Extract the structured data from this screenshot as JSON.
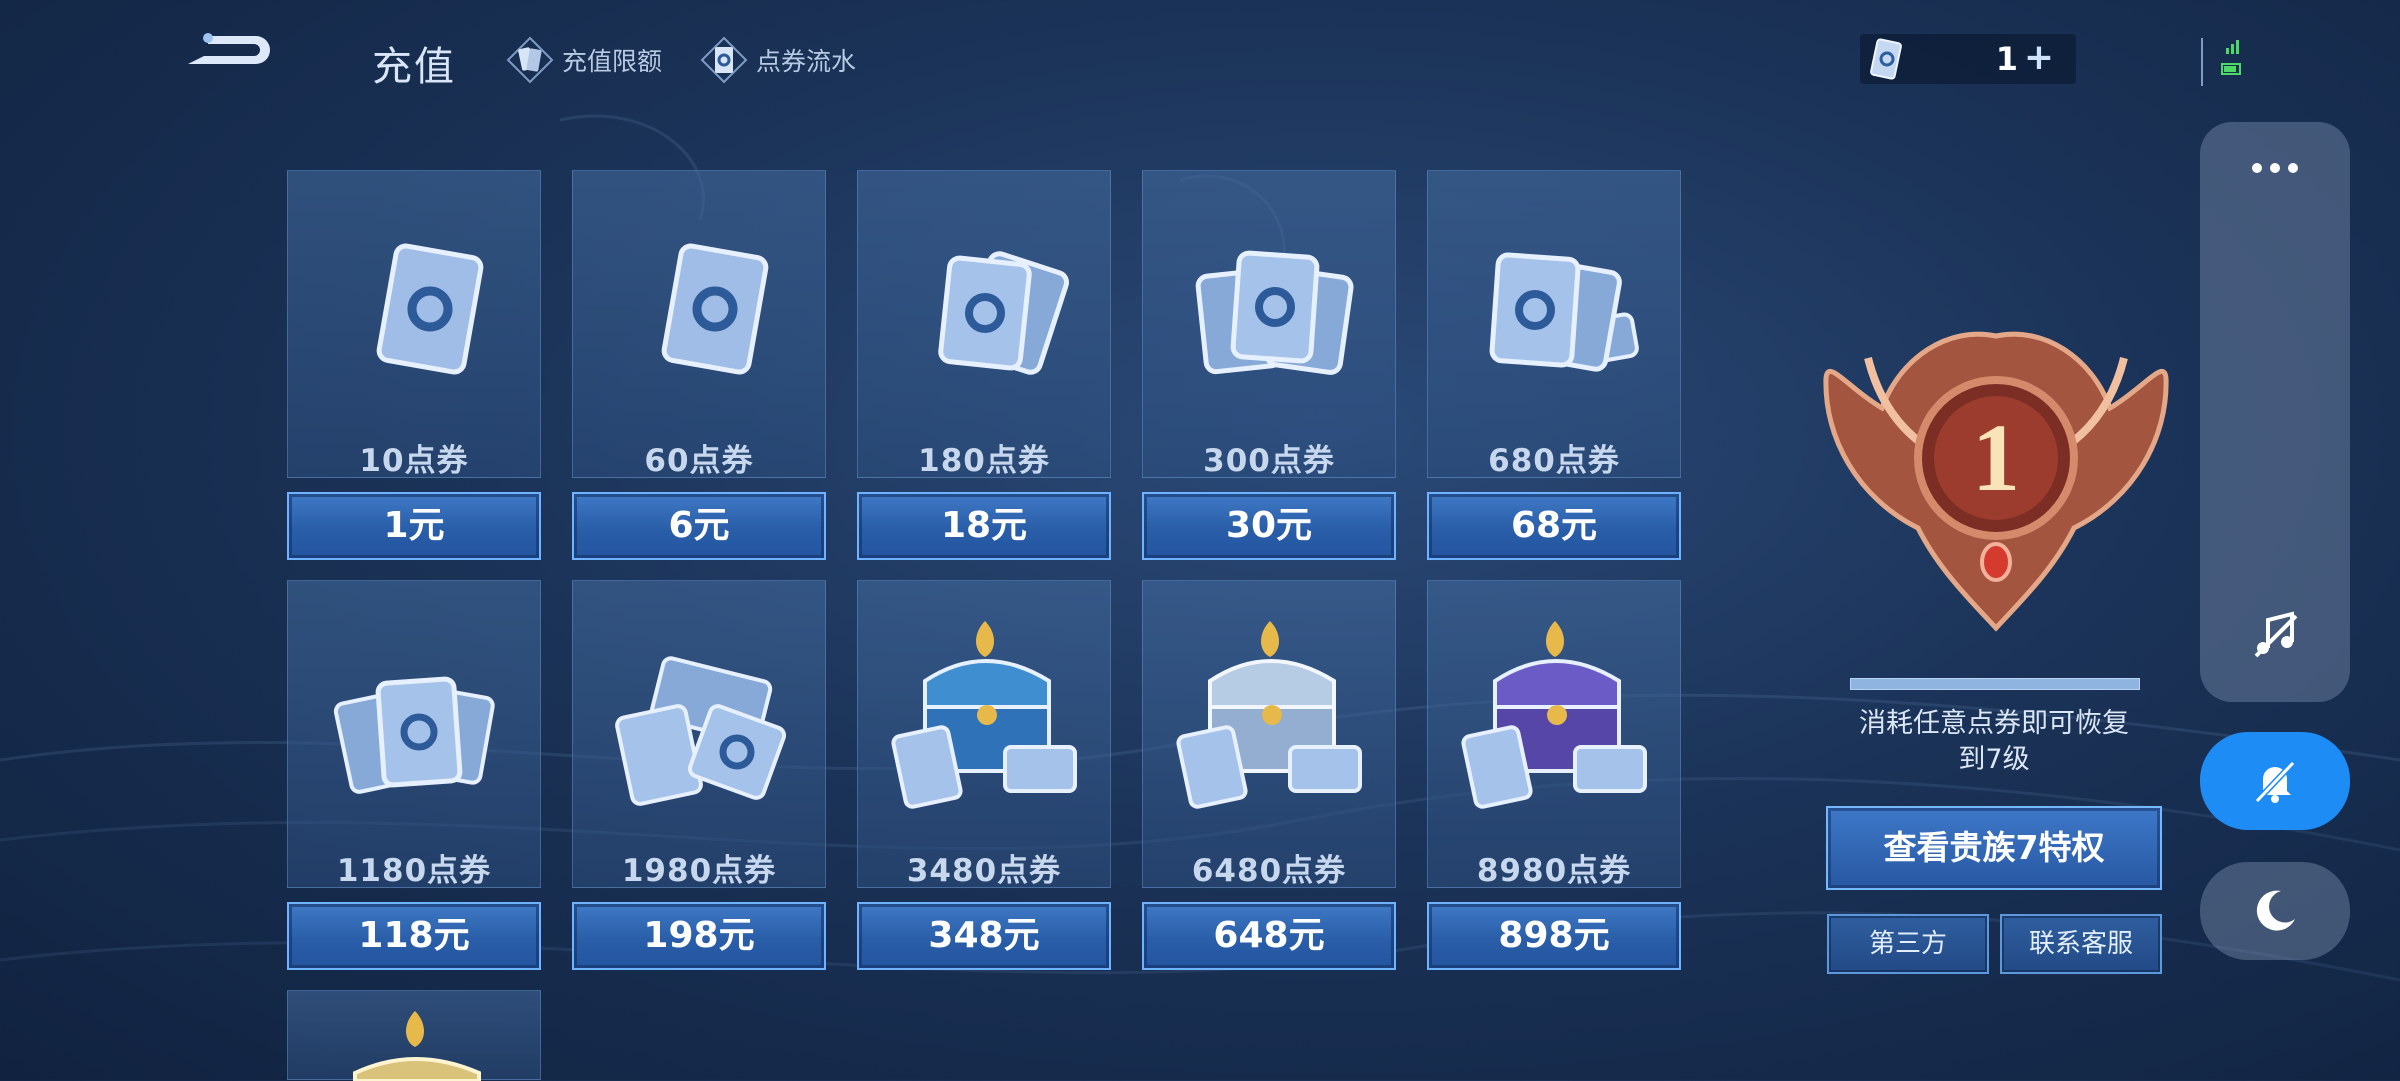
{
  "header": {
    "title": "充值",
    "recharge_limit_label": "充值限额",
    "coupon_flow_label": "点券流水",
    "currency_value": "1",
    "plus_label": "+"
  },
  "products": [
    {
      "amount": "10点券",
      "price": "1元",
      "icon": "coupon-single-icon"
    },
    {
      "amount": "60点券",
      "price": "6元",
      "icon": "coupon-single-icon"
    },
    {
      "amount": "180点券",
      "price": "18元",
      "icon": "coupon-double-icon"
    },
    {
      "amount": "300点券",
      "price": "30元",
      "icon": "coupon-triple-icon"
    },
    {
      "amount": "680点券",
      "price": "68元",
      "icon": "coupon-stack-icon"
    },
    {
      "amount": "1180点券",
      "price": "118元",
      "icon": "coupon-pile-icon"
    },
    {
      "amount": "1980点券",
      "price": "198元",
      "icon": "coupon-heap-icon"
    },
    {
      "amount": "3480点券",
      "price": "348元",
      "icon": "blue-chest-icon"
    },
    {
      "amount": "6480点券",
      "price": "648元",
      "icon": "silver-chest-icon"
    },
    {
      "amount": "8980点券",
      "price": "898元",
      "icon": "purple-chest-icon"
    }
  ],
  "noble": {
    "level": "1",
    "progress": 0.0,
    "restore_text_line1": "消耗任意点券即可恢复",
    "restore_text_line2": "到7级",
    "view_button": "查看贵族7特权",
    "third_party_button": "第三方",
    "contact_button": "联系客服"
  },
  "overlay": {
    "more_icon": "more-dots-icon",
    "music_icon": "music-off-icon",
    "mute_icon": "bell-off-icon",
    "moon_icon": "moon-icon"
  },
  "colors": {
    "accent": "#1d8cf5",
    "button": "#2f67b4",
    "badge": "#b8604a"
  }
}
